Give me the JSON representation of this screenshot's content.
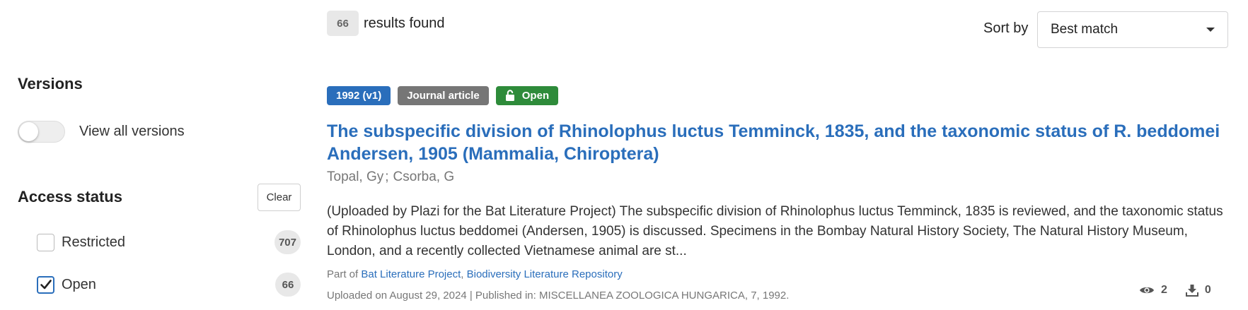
{
  "sidebar": {
    "versions": {
      "title": "Versions",
      "toggle_label": "View all versions",
      "toggle_on": false
    },
    "access_status": {
      "title": "Access status",
      "clear_label": "Clear",
      "items": [
        {
          "label": "Restricted",
          "count": "707",
          "checked": false
        },
        {
          "label": "Open",
          "count": "66",
          "checked": true
        }
      ]
    }
  },
  "results": {
    "count": "66",
    "text": "results found"
  },
  "sort": {
    "label": "Sort by",
    "selected": "Best match"
  },
  "record": {
    "badges": {
      "version": "1992 (v1)",
      "type": "Journal article",
      "access": "Open"
    },
    "title": "The subspecific division of Rhinolophus luctus Temminck, 1835, and the taxonomic status of R. beddomei Andersen, 1905 (Mammalia, Chiroptera)",
    "authors": [
      "Topal, Gy",
      "Csorba, G"
    ],
    "author_separator": ";",
    "description": "(Uploaded by Plazi for the Bat Literature Project) The subspecific division of Rhinolophus luctus Temminck, 1835 is reviewed, and the taxonomic status of Rhinolophus luctus beddomei (Andersen, 1905) is discussed. Specimens in the Bombay Natural History Society, The Natural History Museum, London, and a recently collected Vietnamese animal are st...",
    "part_of_prefix": "Part of",
    "communities": [
      "Bat Literature Project",
      "Biodiversity Literature Repository"
    ],
    "community_separator": ",",
    "uploaded": "Uploaded on August 29, 2024 | Published in: MISCELLANEA ZOOLOGICA HUNGARICA, 7, 1992.",
    "views": "2",
    "downloads": "0"
  },
  "icons": {
    "lock": "unlock-icon",
    "views": "eye-icon",
    "downloads": "download-icon",
    "checkmark": "check-icon",
    "sort_caret": "caret-down-icon"
  },
  "colors": {
    "link": "#2a6ebb",
    "badge_version": "#2a6ebb",
    "badge_type": "#767676",
    "badge_open": "#2e8b3a"
  }
}
